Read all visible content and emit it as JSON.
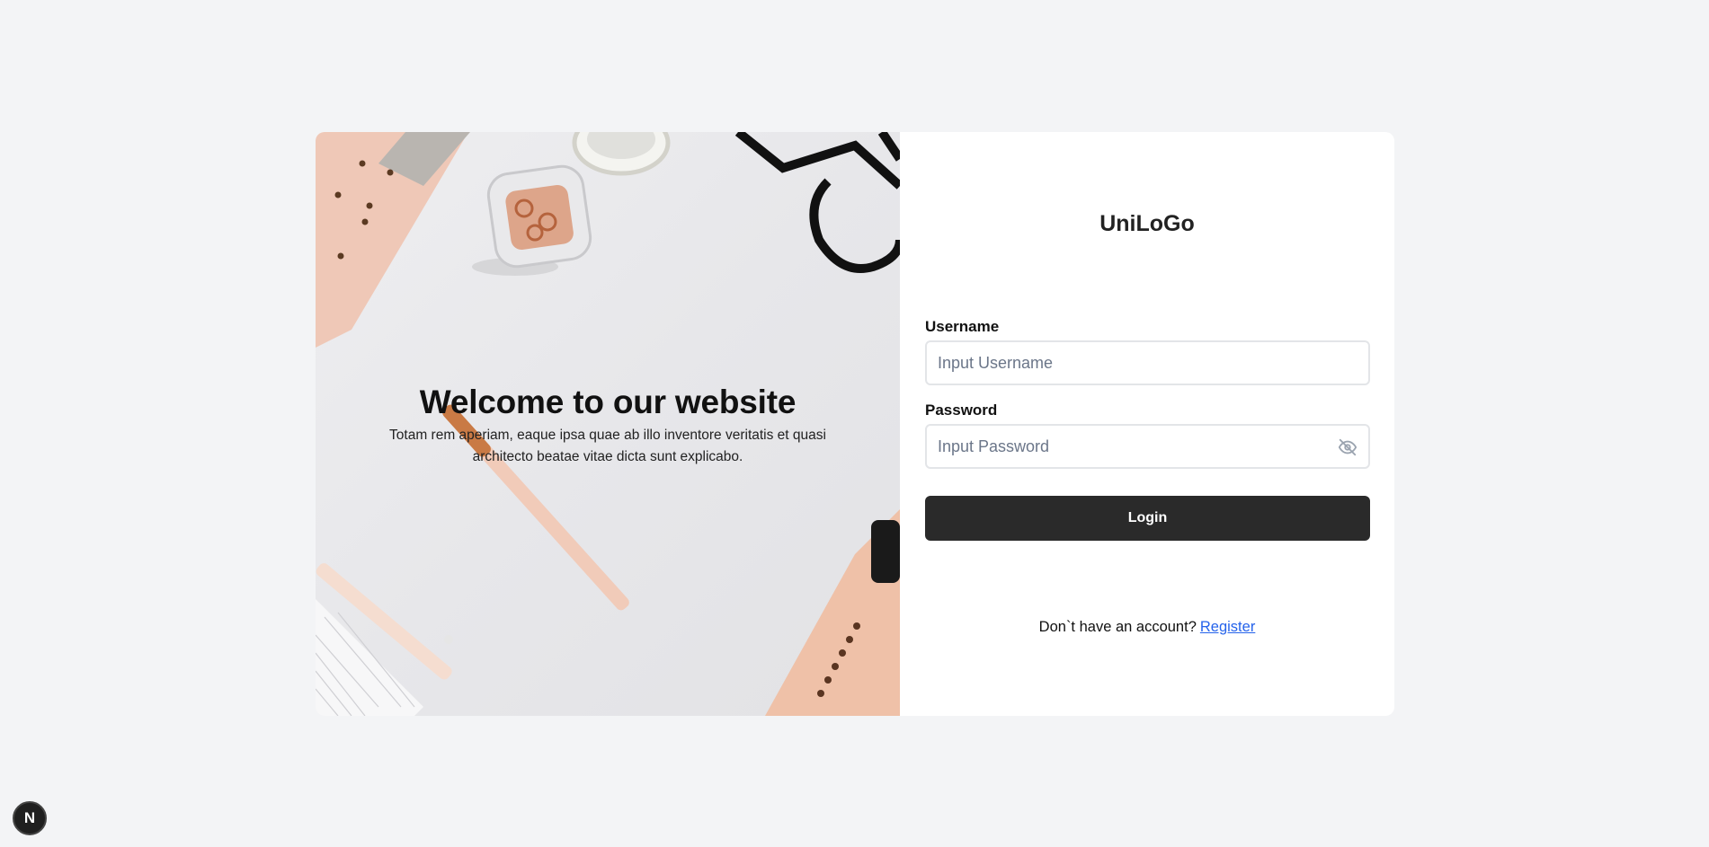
{
  "hero": {
    "title": "Welcome to our website",
    "subtitle": "Totam rem aperiam, eaque ipsa quae ab illo inventore veritatis et quasi architecto beatae vitae dicta sunt explicabo."
  },
  "brand": {
    "name": "UniLoGo"
  },
  "form": {
    "username_label": "Username",
    "username_placeholder": "Input Username",
    "password_label": "Password",
    "password_placeholder": "Input Password",
    "password_toggle_icon": "eye-off-icon",
    "login_label": "Login"
  },
  "footer": {
    "prompt": "Don`t have an account?",
    "register_label": "Register"
  },
  "badge": {
    "letter": "N"
  },
  "colors": {
    "page_bg": "#f3f4f6",
    "button_bg": "#2a2a2a",
    "link": "#2563eb"
  }
}
